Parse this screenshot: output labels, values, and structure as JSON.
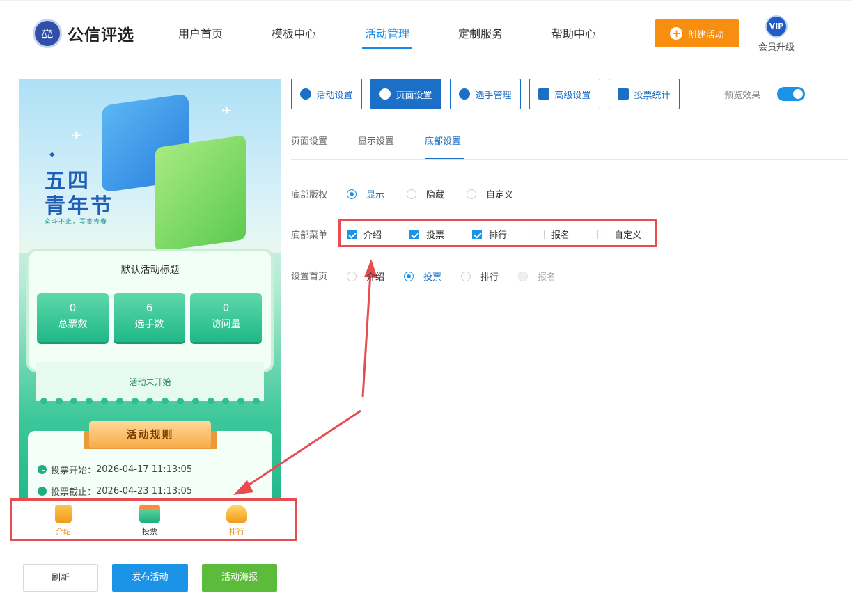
{
  "header": {
    "logo_text": "公信评选",
    "nav": [
      "用户首页",
      "模板中心",
      "活动管理",
      "定制服务",
      "帮助中心"
    ],
    "active_nav": "活动管理",
    "create_label": "创建活动",
    "vip_badge": "VIP",
    "vip_label": "会员升级",
    "accent": "#1989e8",
    "create_color": "#f88e0f"
  },
  "preview": {
    "hero": {
      "line1": "五四",
      "line2": "青年节",
      "slogan": "奋斗不止，写意青春"
    },
    "activity_title": "默认活动标题",
    "stats": [
      {
        "value": "0",
        "label": "总票数"
      },
      {
        "value": "6",
        "label": "选手数"
      },
      {
        "value": "0",
        "label": "访问量"
      }
    ],
    "status": "活动未开始",
    "rules_title": "活动规则",
    "rules": [
      {
        "label": "投票开始：",
        "value": "2026-04-17 11:13:05"
      },
      {
        "label": "投票截止：",
        "value": "2026-04-23 11:13:05"
      }
    ],
    "bottom_nav": [
      {
        "label": "介绍",
        "icon": "document-icon"
      },
      {
        "label": "投票",
        "icon": "ballot-box-icon"
      },
      {
        "label": "排行",
        "icon": "trophy-icon"
      }
    ]
  },
  "actions": {
    "refresh": "刷新",
    "publish": "发布活动",
    "poster": "活动海报"
  },
  "panel": {
    "tabs": [
      {
        "label": "活动设置",
        "icon": "star-icon"
      },
      {
        "label": "页面设置",
        "icon": "gear-icon"
      },
      {
        "label": "选手管理",
        "icon": "users-icon"
      },
      {
        "label": "高级设置",
        "icon": "settings-sliders-icon"
      },
      {
        "label": "投票统计",
        "icon": "bar-chart-icon"
      }
    ],
    "active_tab": "页面设置",
    "preview_label": "预览效果",
    "preview_on": true,
    "subtabs": [
      "页面设置",
      "显示设置",
      "底部设置"
    ],
    "active_subtab": "底部设置",
    "copyright": {
      "label": "底部版权",
      "options": [
        "显示",
        "隐藏",
        "自定义"
      ],
      "selected": "显示"
    },
    "menu": {
      "label": "底部菜单",
      "options": [
        {
          "label": "介绍",
          "checked": true
        },
        {
          "label": "投票",
          "checked": true
        },
        {
          "label": "排行",
          "checked": true
        },
        {
          "label": "报名",
          "checked": false
        },
        {
          "label": "自定义",
          "checked": false
        }
      ]
    },
    "home": {
      "label": "设置首页",
      "options": [
        {
          "label": "介绍",
          "state": "off"
        },
        {
          "label": "投票",
          "state": "on"
        },
        {
          "label": "排行",
          "state": "off"
        },
        {
          "label": "报名",
          "state": "disabled"
        }
      ]
    }
  }
}
